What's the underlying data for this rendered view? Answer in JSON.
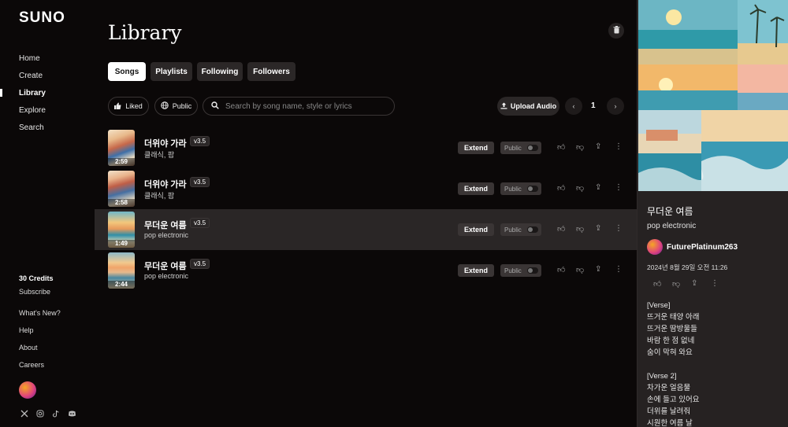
{
  "brand": "SUNO",
  "nav": {
    "home": "Home",
    "create": "Create",
    "library": "Library",
    "explore": "Explore",
    "search": "Search"
  },
  "sidebar_bottom": {
    "credits": "30 Credits",
    "subscribe": "Subscribe",
    "whats_new": "What's New?",
    "help": "Help",
    "about": "About",
    "careers": "Careers"
  },
  "page_title": "Library",
  "tabs": [
    "Songs",
    "Playlists",
    "Following",
    "Followers"
  ],
  "active_tab": "Songs",
  "filters": {
    "liked": "Liked",
    "public": "Public"
  },
  "search": {
    "placeholder": "Search by song name, style or lyrics",
    "value": ""
  },
  "upload_label": "Upload Audio",
  "page_number": "1",
  "songs": [
    {
      "title": "더위야 가라",
      "version": "v3.5",
      "style": "클래식, 팝",
      "duration": "2:59",
      "extend": "Extend",
      "visibility": "Public",
      "selected": false
    },
    {
      "title": "더위야 가라",
      "version": "v3.5",
      "style": "클래식, 팝",
      "duration": "2:58",
      "extend": "Extend",
      "visibility": "Public",
      "selected": false
    },
    {
      "title": "무더운 여름",
      "version": "v3.5",
      "style": "pop electronic",
      "duration": "1:49",
      "extend": "Extend",
      "visibility": "Public",
      "selected": true
    },
    {
      "title": "무더운 여름",
      "version": "v3.5",
      "style": "pop electronic",
      "duration": "2:44",
      "extend": "Extend",
      "visibility": "Public",
      "selected": false
    }
  ],
  "detail": {
    "title": "무더운 여름",
    "style": "pop electronic",
    "user": "FuturePlatinum263",
    "date": "2024년 8월 29일 오전 11:26",
    "lyrics": "[Verse]\n뜨거운 태양 아래\n뜨거운 땀방울들\n바람 한 점 없네\n숨이 막혀 와요\n\n[Verse 2]\n차가운 얼음물\n손에 들고 있어요\n더위를 날려줘\n시원한 여름 날"
  },
  "colors": {
    "background": "#0b0808",
    "panel": "#262222",
    "selected_row": "#2a2626",
    "accent_active_tab": "#ffffff"
  },
  "icons": [
    "trash-icon",
    "thumbs-up-icon",
    "globe-icon",
    "search-icon",
    "upload-icon",
    "chevron-left-icon",
    "chevron-right-icon",
    "dislike-icon",
    "share-icon",
    "more-icon",
    "x-icon",
    "instagram-icon",
    "tiktok-icon",
    "discord-icon"
  ]
}
